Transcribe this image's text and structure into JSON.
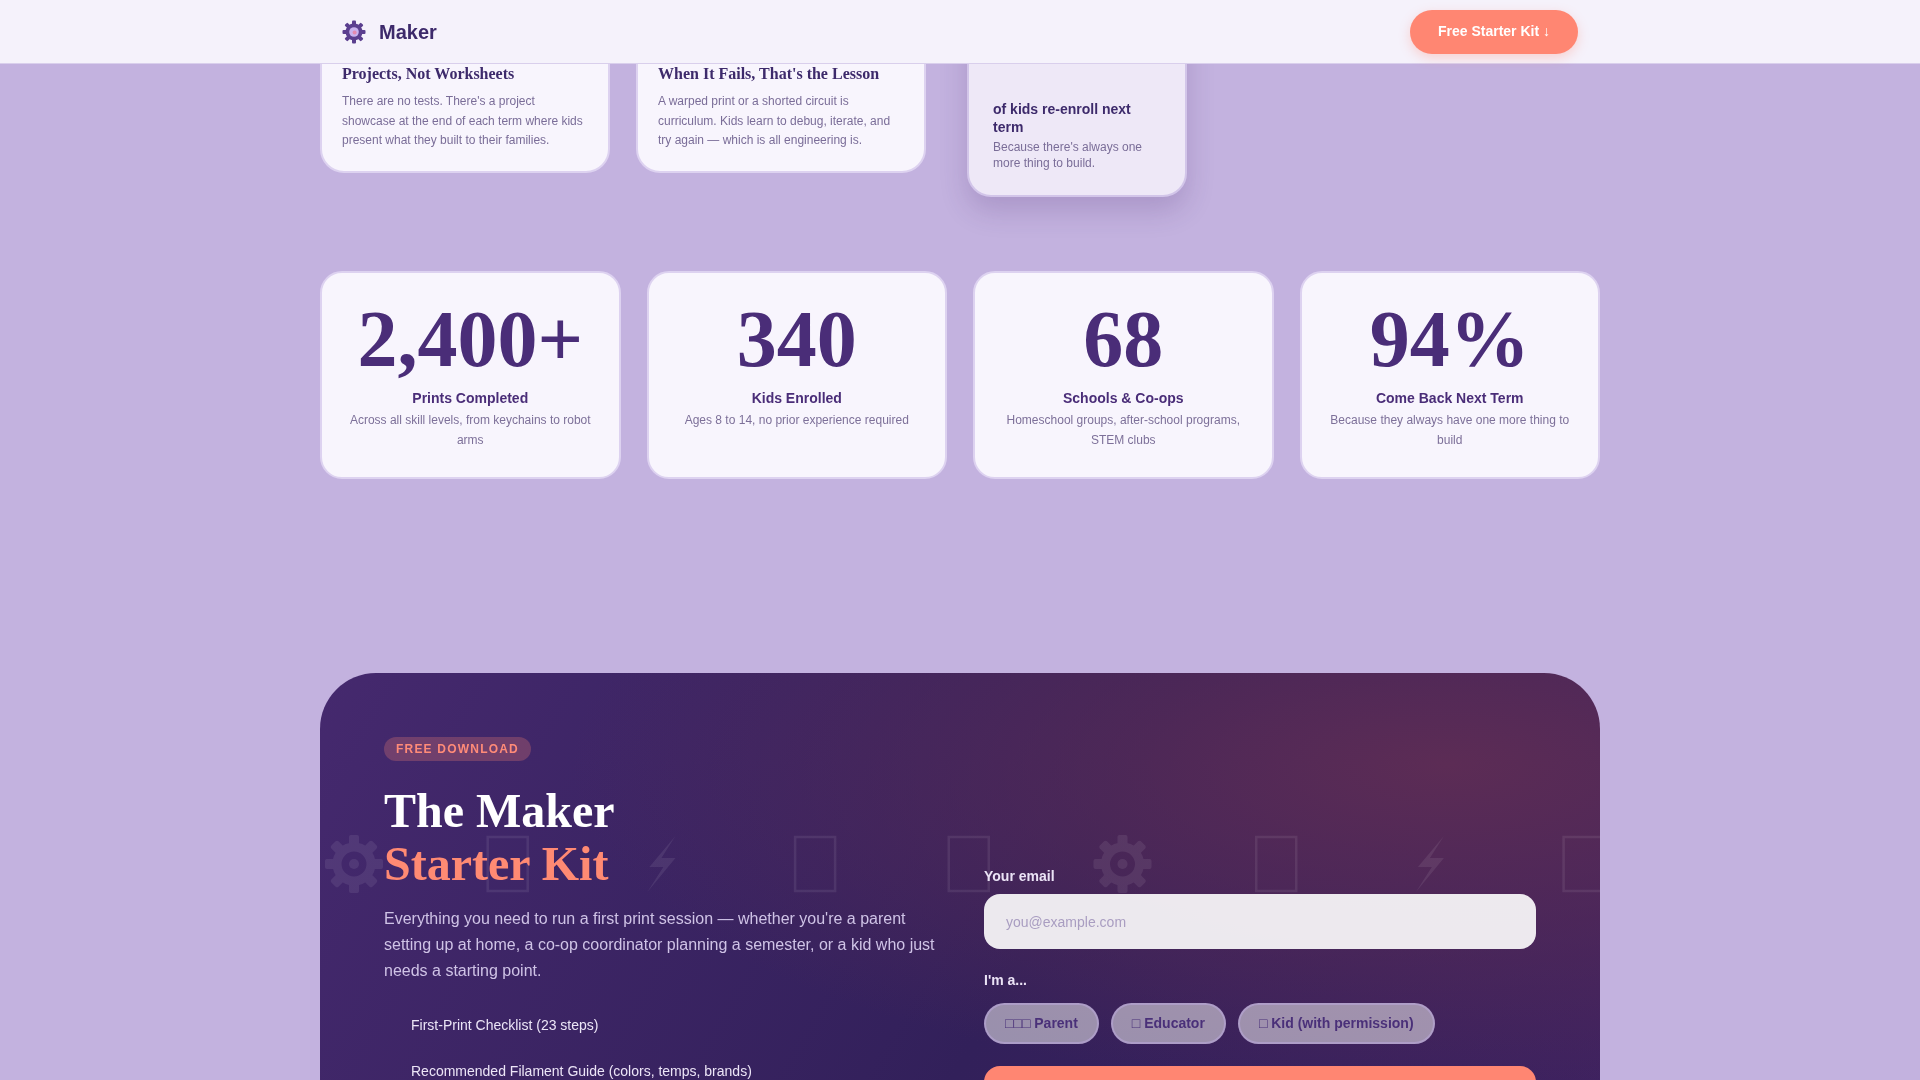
{
  "nav": {
    "brand": "Maker",
    "cta": "Free Starter Kit ↓"
  },
  "feature_cards": [
    {
      "title": "Projects, Not Worksheets",
      "text": "There are no tests. There's a project showcase at the end of each term where kids present what they built to their families."
    },
    {
      "title": "When It Fails, That's the Lesson",
      "text": "A warped print or a shorted circuit is curriculum. Kids learn to debug, iterate, and try again — which is all engineering is."
    }
  ],
  "highlight_card": {
    "label": "of kids re-enroll next term",
    "text": "Because there's always one more thing to build."
  },
  "stats": [
    {
      "value": "2,400+",
      "label": "Prints Completed",
      "text": "Across all skill levels, from keychains to robot arms"
    },
    {
      "value": "340",
      "label": "Kids Enrolled",
      "text": "Ages 8 to 14, no prior experience required"
    },
    {
      "value": "68",
      "label": "Schools & Co-ops",
      "text": "Homeschool groups, after-school programs, STEM clubs"
    },
    {
      "value": "94%",
      "label": "Come Back Next Term",
      "text": "Because they always have one more thing to build"
    }
  ],
  "starter_kit": {
    "badge": "FREE DOWNLOAD",
    "heading": "The Maker",
    "heading_highlight": "Starter Kit",
    "description": "Everything you need to run a first print session — whether you're a parent setting up at home, a co-op coordinator planning a semester, or a kid who just needs a starting point.",
    "items": [
      "First-Print Checklist (23 steps)",
      "Recommended Filament Guide (colors, temps, brands)"
    ],
    "email": {
      "label": "Your email",
      "placeholder": "you@example.com"
    },
    "role": {
      "label": "I'm a...",
      "options": [
        {
          "label": "□□□ Parent",
          "selected": false
        },
        {
          "label": "□ Educator",
          "selected": false
        },
        {
          "label": "□ Kid (with permission)",
          "selected": false
        }
      ]
    },
    "submit": {
      "kind": "primary"
    }
  }
}
